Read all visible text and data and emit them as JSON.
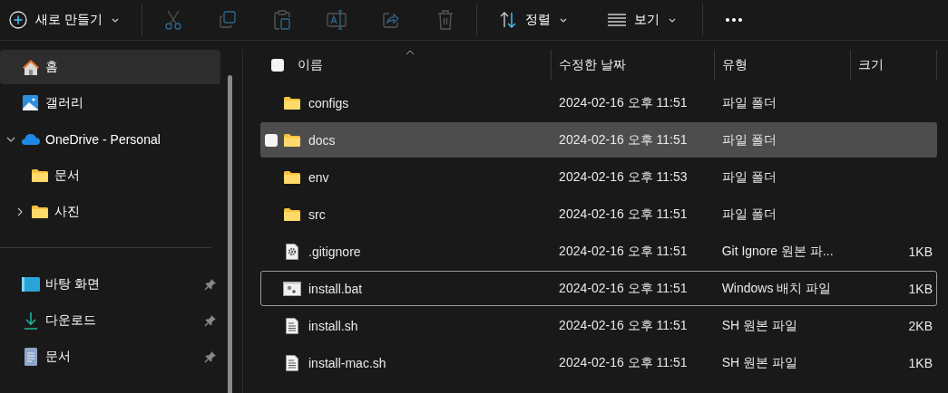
{
  "toolbar": {
    "new_button": {
      "label": "새로 만들기"
    },
    "actions": [
      {
        "kind": "cut",
        "disabled": true
      },
      {
        "kind": "copy",
        "disabled": true
      },
      {
        "kind": "paste",
        "disabled": true
      },
      {
        "kind": "rename",
        "disabled": true
      },
      {
        "kind": "share",
        "disabled": true
      },
      {
        "kind": "delete",
        "disabled": true
      }
    ],
    "sort_button": {
      "label": "정렬"
    },
    "view_button": {
      "label": "보기"
    }
  },
  "sidebar": {
    "items": [
      {
        "label": "홈",
        "kind": "home",
        "selected": true
      },
      {
        "label": "갤러리",
        "kind": "gallery",
        "selected": false
      },
      {
        "label": "OneDrive - Personal",
        "kind": "cloud",
        "selected": false,
        "expanded": true,
        "children": [
          {
            "label": "문서",
            "kind": "folder",
            "selected": false
          },
          {
            "label": "사진",
            "kind": "folder",
            "selected": false,
            "expanded": false
          }
        ]
      }
    ],
    "quick_access": [
      {
        "label": "바탕 화면",
        "kind": "desktop",
        "pinned": true
      },
      {
        "label": "다운로드",
        "kind": "download",
        "pinned": true
      },
      {
        "label": "문서",
        "kind": "document",
        "pinned": true
      }
    ]
  },
  "table": {
    "select_all": {
      "checked": false
    },
    "columns": [
      {
        "label": "이름",
        "sorted": true
      },
      {
        "label": "수정한 날짜",
        "sorted": false
      },
      {
        "label": "유형",
        "sorted": false
      },
      {
        "label": "크기",
        "sorted": false
      }
    ],
    "rows": [
      {
        "name": "configs",
        "kind": "folder",
        "date": "2024-02-16 오후 11:51",
        "type": "파일 폴더",
        "hovered": false,
        "focused": false
      },
      {
        "name": "docs",
        "kind": "folder",
        "date": "2024-02-16 오후 11:51",
        "type": "파일 폴더",
        "hovered": true,
        "focused": false
      },
      {
        "name": "env",
        "kind": "folder",
        "date": "2024-02-16 오후 11:53",
        "type": "파일 폴더",
        "hovered": false,
        "focused": false
      },
      {
        "name": "src",
        "kind": "folder",
        "date": "2024-02-16 오후 11:51",
        "type": "파일 폴더",
        "hovered": false,
        "focused": false
      },
      {
        "name": ".gitignore",
        "kind": "config",
        "date": "2024-02-16 오후 11:51",
        "type": "Git Ignore 원본 파...",
        "size": "1KB",
        "hovered": false,
        "focused": false
      },
      {
        "name": "install.bat",
        "kind": "batch",
        "date": "2024-02-16 오후 11:51",
        "type": "Windows 배치 파일",
        "size": "1KB",
        "hovered": false,
        "focused": true
      },
      {
        "name": "install.sh",
        "kind": "script",
        "date": "2024-02-16 오후 11:51",
        "type": "SH 원본 파일",
        "size": "2KB",
        "hovered": false,
        "focused": false
      },
      {
        "name": "install-mac.sh",
        "kind": "script",
        "date": "2024-02-16 오후 11:51",
        "type": "SH 원본 파일",
        "size": "1KB",
        "hovered": false,
        "focused": false
      }
    ]
  }
}
